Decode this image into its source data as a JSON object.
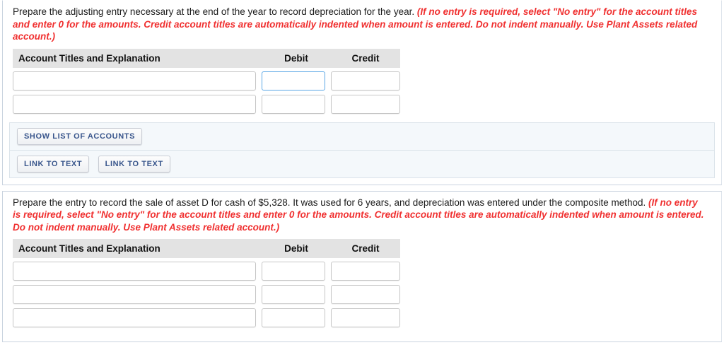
{
  "sections": [
    {
      "prompt": {
        "lead": "Prepare the adjusting entry necessary at the end of the year to record depreciation for the year. ",
        "hint": "(If no entry is required, select \"No entry\" for the account titles and enter 0 for the amounts. Credit account titles are automatically indented when amount is entered. Do not indent manually. Use Plant Assets related account.)"
      },
      "table": {
        "headers": {
          "account": "Account Titles and Explanation",
          "debit": "Debit",
          "credit": "Credit"
        },
        "rows": [
          {
            "account": "",
            "debit": "",
            "credit": "",
            "focused": "debit"
          },
          {
            "account": "",
            "debit": "",
            "credit": "",
            "focused": ""
          }
        ]
      },
      "button_panels": [
        {
          "buttons": [
            {
              "label": "SHOW LIST OF ACCOUNTS",
              "name": "show-list-of-accounts-button"
            }
          ]
        },
        {
          "buttons": [
            {
              "label": "LINK TO TEXT",
              "name": "link-to-text-button-1"
            },
            {
              "label": "LINK TO TEXT",
              "name": "link-to-text-button-2"
            }
          ]
        }
      ]
    },
    {
      "prompt": {
        "lead": "Prepare the entry to record the sale of asset D for cash of $5,328. It was used for 6 years, and depreciation was entered under the composite method. ",
        "hint": "(If no entry is required, select \"No entry\" for the account titles and enter 0 for the amounts. Credit account titles are automatically indented when amount is entered. Do not indent manually. Use Plant Assets related account.)"
      },
      "table": {
        "headers": {
          "account": "Account Titles and Explanation",
          "debit": "Debit",
          "credit": "Credit"
        },
        "rows": [
          {
            "account": "",
            "debit": "",
            "credit": "",
            "focused": ""
          },
          {
            "account": "",
            "debit": "",
            "credit": "",
            "focused": ""
          },
          {
            "account": "",
            "debit": "",
            "credit": "",
            "focused": ""
          }
        ]
      },
      "button_panels": []
    }
  ],
  "colors": {
    "hint_red": "#f03030",
    "header_gray": "#e3e3e3",
    "button_text": "#39568c",
    "focus_blue": "#5ba7e5",
    "panel_bg": "#f4f8fb"
  }
}
